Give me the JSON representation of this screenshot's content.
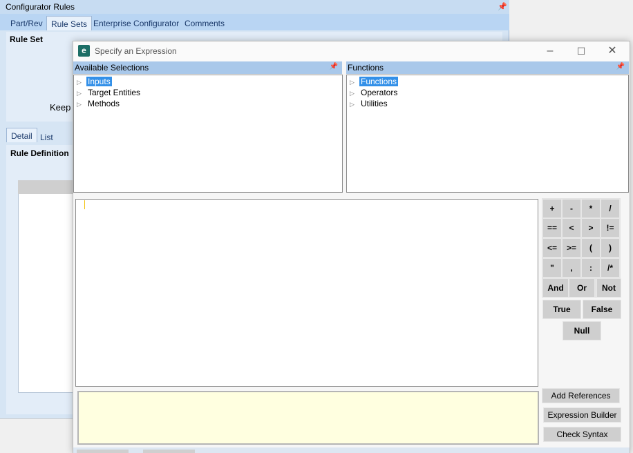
{
  "background_window": {
    "title": "Configurator Rules",
    "tabs": [
      "Part/Rev",
      "Rule Sets",
      "Enterprise Configurator",
      "Comments"
    ],
    "active_tab": "Rule Sets",
    "rule_set_label": "Rule Set",
    "keep_label": "Keep (",
    "detail_tabs": [
      "Detail",
      "List"
    ],
    "rule_definition_label": "Rule Definition"
  },
  "dialog": {
    "title": "Specify an Expression",
    "icon_letter": "e",
    "available_selections": {
      "header": "Available Selections",
      "items": [
        {
          "label": "Inputs",
          "selected": true
        },
        {
          "label": "Target Entities",
          "selected": false
        },
        {
          "label": "Methods",
          "selected": false
        }
      ]
    },
    "functions": {
      "header": "Functions",
      "items": [
        {
          "label": "Functions",
          "selected": true
        },
        {
          "label": "Operators",
          "selected": false
        },
        {
          "label": "Utilities",
          "selected": false
        }
      ]
    },
    "operators": [
      "+",
      "-",
      "*",
      "/",
      "==",
      "<",
      ">",
      "!=",
      "<=",
      ">=",
      "(",
      ")",
      "\"",
      ",",
      ":",
      "/*"
    ],
    "logic": [
      "And",
      "Or",
      "Not"
    ],
    "bools": [
      "True",
      "False"
    ],
    "null_label": "Null",
    "commands": {
      "add_references": "Add References",
      "expression_builder": "Expression Builder",
      "check_syntax": "Check Syntax"
    }
  },
  "colors": {
    "pane_header": "#a9c8ea",
    "selection": "#3390e8",
    "message_bg": "#ffffe0"
  }
}
